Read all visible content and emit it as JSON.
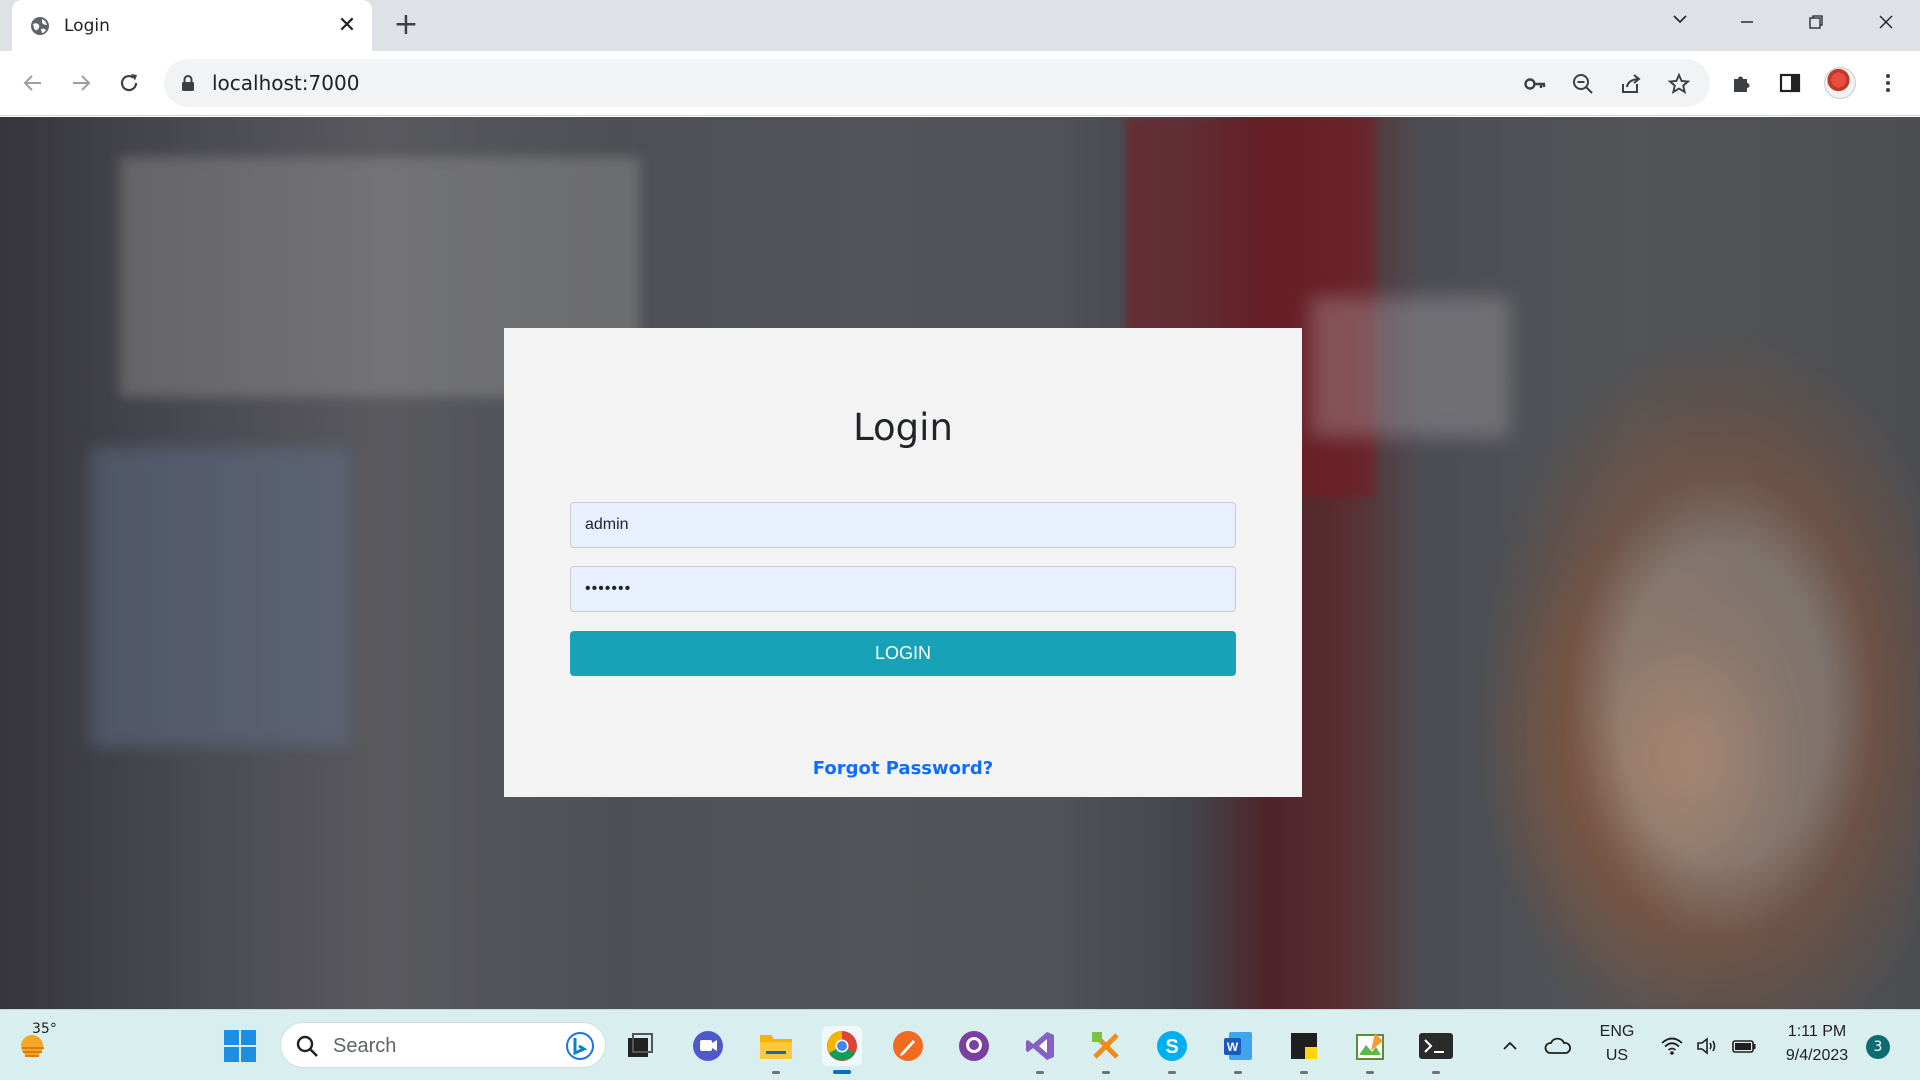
{
  "browser": {
    "tab_title": "Login",
    "url": "localhost:7000"
  },
  "login": {
    "title": "Login",
    "username_value": "admin",
    "password_value": "•••••••",
    "button_label": "LOGIN",
    "forgot_label": "Forgot Password?",
    "accent_color": "#17a2b8",
    "link_color": "#0d6efd"
  },
  "taskbar": {
    "weather_temp": "35°",
    "search_placeholder": "Search",
    "lang_line1": "ENG",
    "lang_line2": "US",
    "time": "1:11 PM",
    "date": "9/4/2023",
    "notification_count": "3",
    "pinned_apps": [
      "windows-start",
      "file-explorer-dark",
      "teams",
      "file-explorer",
      "chrome",
      "pen-app",
      "github-desktop",
      "visual-studio",
      "xmind",
      "skype",
      "word",
      "sticky-notes",
      "paint-app",
      "terminal"
    ]
  }
}
